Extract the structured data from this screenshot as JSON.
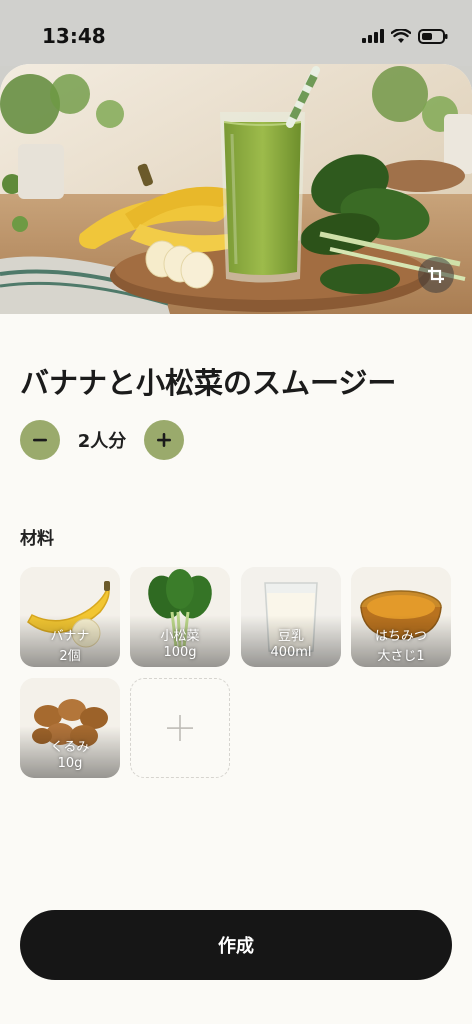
{
  "status_bar": {
    "time": "13:48",
    "icons": [
      "signal-icon",
      "wifi-icon",
      "battery-icon"
    ]
  },
  "hero": {
    "image": "green-smoothie-with-bananas-and-komatsuna-photo",
    "crop_icon": "crop-icon"
  },
  "recipe": {
    "title": "バナナと小松菜のスムージー",
    "servings_label": "2人分",
    "decrease_icon": "minus-icon",
    "increase_icon": "plus-icon"
  },
  "ingredients": {
    "section_label": "材料",
    "items": [
      {
        "name": "バナナ",
        "qty": "2個",
        "image": "banana"
      },
      {
        "name": "小松菜",
        "qty": "100g",
        "image": "komatsuna"
      },
      {
        "name": "豆乳",
        "qty": "400ml",
        "image": "soy-milk"
      },
      {
        "name": "はちみつ",
        "qty": "大さじ1",
        "image": "honey"
      },
      {
        "name": "くるみ",
        "qty": "10g",
        "image": "walnuts"
      }
    ],
    "add_icon": "plus-icon"
  },
  "actions": {
    "create_label": "作成"
  },
  "colors": {
    "accent": "#9aaa6c",
    "primary_button": "#161616",
    "background": "#fbfaf6"
  }
}
